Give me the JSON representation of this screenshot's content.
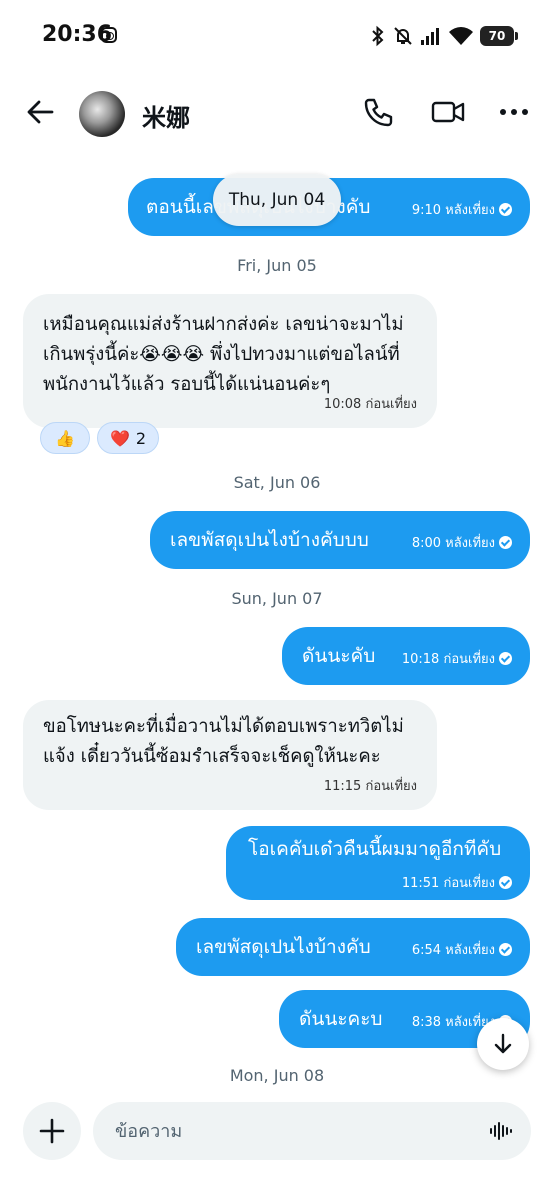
{
  "status_bar": {
    "time": "20:36",
    "battery": "70"
  },
  "header": {
    "contact_name": "米娜"
  },
  "chat": {
    "dates": {
      "jun04": "Thu, Jun 04",
      "jun05": "Fri, Jun 05",
      "jun06": "Sat, Jun 06",
      "jun07": "Sun, Jun 07",
      "jun08": "Mon, Jun 08"
    },
    "messages": [
      {
        "text": "ตอนนี้เลขพัสดุเปนไงบ้างคับ",
        "time": "9:10 หลังเที่ยง"
      },
      {
        "text": "เหมือนคุณแม่ส่งร้านฝากส่งค่ะ เลขน่าจะมาไม่เกินพรุ่งนี้ค่ะ😭😭😭 พึ่งไปทวงมาแต่ขอไลน์ที่พนักงานไว้แล้ว รอบนี้ได้แน่นอนค่ะๆ",
        "time": "10:08 ก่อนเที่ยง"
      },
      {
        "text": "เลขพัสดุเปนไงบ้างคับบบ",
        "time": "8:00 หลังเที่ยง"
      },
      {
        "text": "ดันนะคับ",
        "time": "10:18 ก่อนเที่ยง"
      },
      {
        "text": "ขอโทษนะคะที่เมื่อวานไม่ได้ตอบเพราะทวิตไม่แจ้ง เดี๋ยววันนี้ซ้อมรำเสร็จจะเช็คดูให้นะคะ",
        "time": "11:15 ก่อนเที่ยง"
      },
      {
        "text": "โอเคคับเด๋วคืนนี้ผมมาดูอีกทีคับ",
        "time": "11:51 ก่อนเที่ยง"
      },
      {
        "text": "เลขพัสดุเปนไงบ้างคับ",
        "time": "6:54 หลังเที่ยง"
      },
      {
        "text": "ดันนะคะบ",
        "time": "8:38 หลังเที่ยง"
      }
    ],
    "reactions": [
      {
        "emoji": "👍",
        "count": ""
      },
      {
        "emoji": "❤️",
        "count": "2"
      }
    ]
  },
  "composer": {
    "placeholder": "ข้อความ"
  },
  "colors": {
    "outgoing_bubble": "#1d9bf0",
    "incoming_bubble": "#eff3f4",
    "date_text": "#536471"
  }
}
